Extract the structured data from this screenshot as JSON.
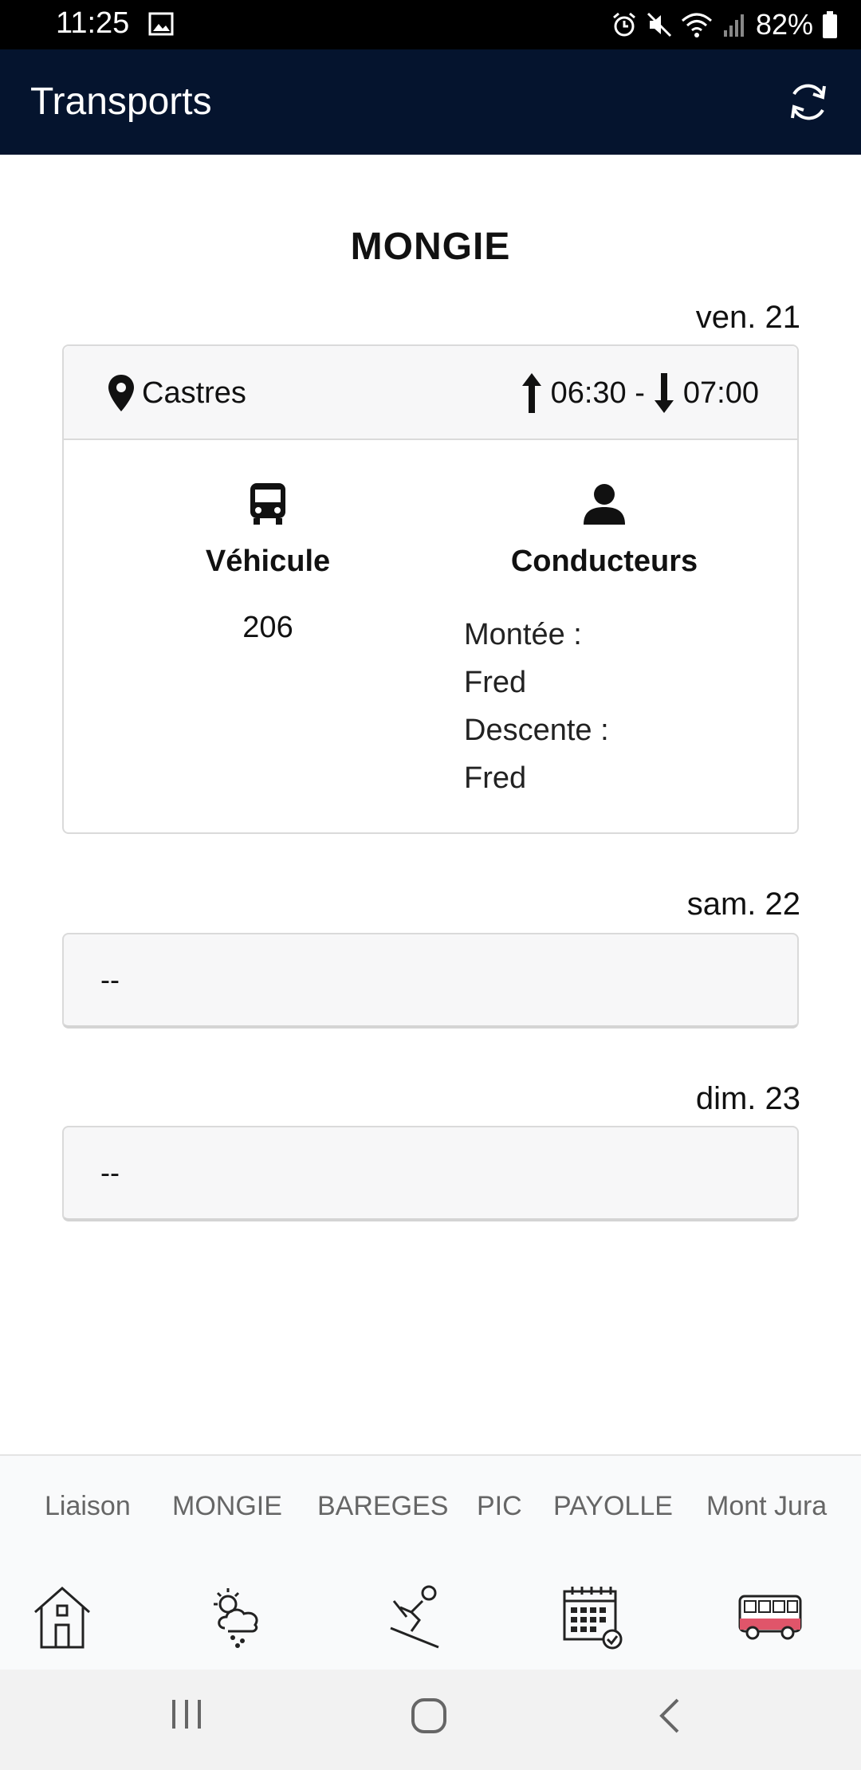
{
  "status_bar": {
    "time": "11:25",
    "battery": "82%"
  },
  "app_bar": {
    "title": "Transports"
  },
  "page": {
    "title": "MONGIE"
  },
  "days": [
    {
      "label": "ven. 21",
      "location": "Castres",
      "depart": "06:30 -",
      "arrival": "07:00",
      "vehicle_header": "Véhicule",
      "vehicle": "206",
      "drivers_header": "Conducteurs",
      "drivers": [
        "Montée :",
        "Fred",
        "Descente :",
        "Fred"
      ]
    },
    {
      "label": "sam. 22",
      "empty": "--"
    },
    {
      "label": "dim. 23",
      "empty": "--"
    }
  ],
  "tabs": [
    "Liaison",
    "MONGIE",
    "BAREGES",
    "PIC",
    "PAYOLLE",
    "Mont Jura"
  ],
  "nav_icons": [
    "home-icon",
    "weather-icon",
    "skier-icon",
    "calendar-icon",
    "bus-icon"
  ],
  "colors": {
    "app_bar": "#05142e",
    "status_bar": "#000000",
    "bus_red": "#e0556a"
  }
}
